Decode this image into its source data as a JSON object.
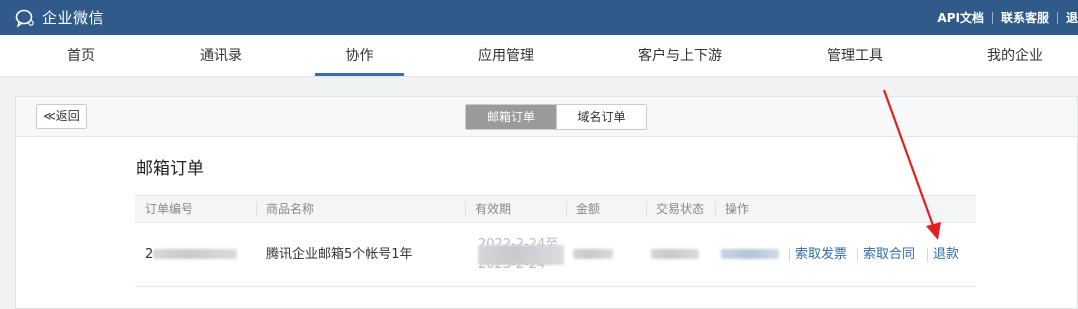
{
  "topbar": {
    "brand": "企业微信",
    "links": [
      "API文档",
      "联系客服",
      "退"
    ]
  },
  "nav": {
    "items": [
      "首页",
      "通讯录",
      "协作",
      "应用管理",
      "客户与上下游",
      "管理工具",
      "我的企业"
    ],
    "active_index": 2
  },
  "toolbar": {
    "back_label": "≪返回",
    "tabs": [
      "邮箱订单",
      "域名订单"
    ],
    "active_tab": "邮箱订单"
  },
  "orders": {
    "title": "邮箱订单",
    "columns": [
      "订单编号",
      "商品名称",
      "有效期",
      "金额",
      "交易状态",
      "操作"
    ],
    "rows": [
      {
        "order_id_prefix": "2",
        "product": "腾讯企业邮箱5个帐号1年",
        "validity": "2022-2-24至2023-2-24",
        "actions": [
          "索取发票",
          "索取合同",
          "退款"
        ]
      }
    ]
  },
  "annotation": {
    "color": "#e02020"
  }
}
